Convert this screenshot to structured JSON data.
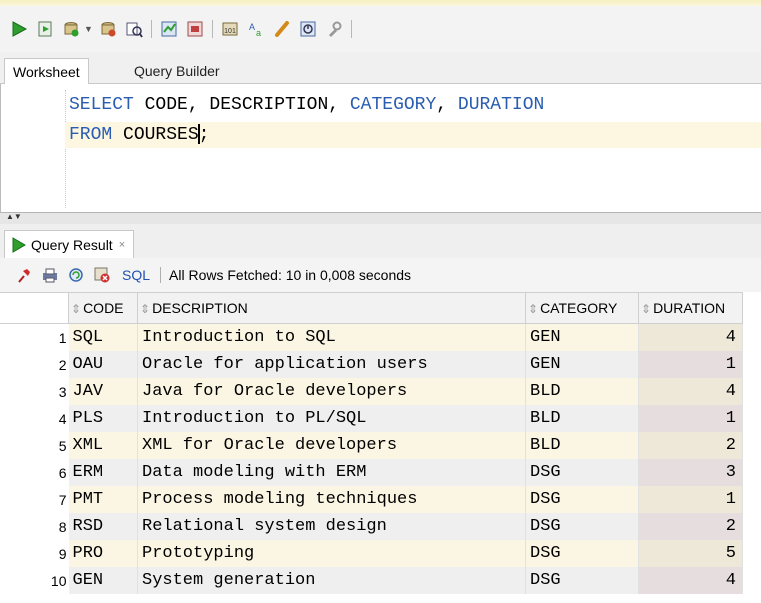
{
  "toolbar": {
    "icons": [
      "run-statement-icon",
      "run-script-icon",
      "commit-icon",
      "rollback-icon",
      "explain-plan-icon",
      "autotrace-icon",
      "sql-tuning-icon",
      "unshared-sql-icon",
      "clear-icon",
      "sql-history-icon",
      "format-icon"
    ]
  },
  "tabs": {
    "worksheet": "Worksheet",
    "query_builder": "Query Builder"
  },
  "editor": {
    "line1": {
      "kw1": "SELECT",
      "t1": " CODE, DESCRIPTION, ",
      "kw2": "CATEGORY",
      "t2": ", ",
      "kw3": "DURATION"
    },
    "line2": {
      "kw1": "FROM",
      "t1": " COURSES",
      "t2": ";"
    }
  },
  "result": {
    "tab_label": "Query Result",
    "close": "×",
    "sql_link": "SQL",
    "status": "All Rows Fetched: 10 in 0,008 seconds"
  },
  "grid": {
    "columns": [
      "CODE",
      "DESCRIPTION",
      "CATEGORY",
      "DURATION"
    ],
    "rows": [
      {
        "n": "1",
        "code": "SQL",
        "description": "Introduction to SQL",
        "category": "GEN",
        "duration": "4"
      },
      {
        "n": "2",
        "code": "OAU",
        "description": "Oracle for application users",
        "category": "GEN",
        "duration": "1"
      },
      {
        "n": "3",
        "code": "JAV",
        "description": "Java for Oracle developers",
        "category": "BLD",
        "duration": "4"
      },
      {
        "n": "4",
        "code": "PLS",
        "description": "Introduction to PL/SQL",
        "category": "BLD",
        "duration": "1"
      },
      {
        "n": "5",
        "code": "XML",
        "description": "XML for Oracle developers",
        "category": "BLD",
        "duration": "2"
      },
      {
        "n": "6",
        "code": "ERM",
        "description": "Data modeling with ERM",
        "category": "DSG",
        "duration": "3"
      },
      {
        "n": "7",
        "code": "PMT",
        "description": "Process modeling techniques",
        "category": "DSG",
        "duration": "1"
      },
      {
        "n": "8",
        "code": "RSD",
        "description": "Relational system design",
        "category": "DSG",
        "duration": "2"
      },
      {
        "n": "9",
        "code": "PRO",
        "description": "Prototyping",
        "category": "DSG",
        "duration": "5"
      },
      {
        "n": "10",
        "code": "GEN",
        "description": "System generation",
        "category": "DSG",
        "duration": "4"
      }
    ]
  },
  "colors": {
    "keyword": "#2a5db0",
    "run_green": "#2e9e2e",
    "link_blue": "#2050b0"
  }
}
